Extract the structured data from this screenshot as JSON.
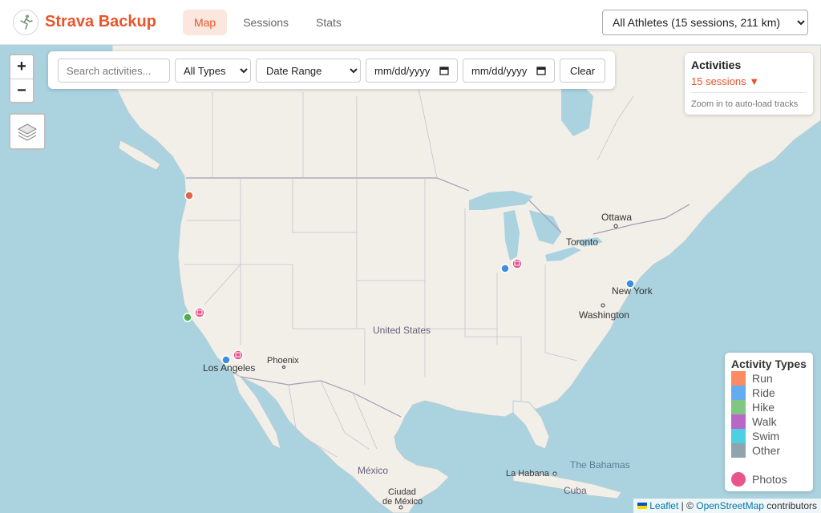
{
  "app": {
    "name": "Strava Backup"
  },
  "nav": {
    "tabs": [
      {
        "label": "Map"
      },
      {
        "label": "Sessions"
      },
      {
        "label": "Stats"
      }
    ]
  },
  "athlete_filter": {
    "selected": "All Athletes (15 sessions, 211 km)"
  },
  "zoom": {
    "in_label": "+",
    "out_label": "−"
  },
  "filters": {
    "search_placeholder": "Search activities...",
    "type_selected": "All Types",
    "range_selected": "Date Range",
    "date_from": "mm/dd/yyyy",
    "date_to": "mm/dd/yyyy",
    "clear_label": "Clear"
  },
  "activities_panel": {
    "title": "Activities",
    "count": "15 sessions ▼",
    "hint": "Zoom in to auto-load tracks"
  },
  "legend": {
    "title": "Activity Types",
    "items": [
      {
        "label": "Run",
        "color": "#fc8b62"
      },
      {
        "label": "Ride",
        "color": "#65abef"
      },
      {
        "label": "Hike",
        "color": "#81c784"
      },
      {
        "label": "Walk",
        "color": "#b967c7"
      },
      {
        "label": "Swim",
        "color": "#4dd0e1"
      },
      {
        "label": "Other",
        "color": "#90a4ae"
      }
    ],
    "photos_label": "Photos",
    "photos_color": "#e6558c"
  },
  "map_labels": {
    "ottawa": "Ottawa",
    "toronto": "Toronto",
    "new_york": "New York",
    "washington": "Washington",
    "united_states": "United States",
    "phoenix": "Phoenix",
    "los_angeles": "Los Angeles",
    "mexico": "México",
    "ciudad": "Ciudad",
    "de_mexico": "de México",
    "la_habana": "La Habana",
    "the_bahamas": "The Bahamas",
    "cuba": "Cuba"
  },
  "attribution": {
    "leaflet": "Leaflet",
    "separator": " | © ",
    "osm": "OpenStreetMap",
    "suffix": " contributors"
  },
  "colors": {
    "brand": "#e8552a",
    "run_marker": "#d9694a",
    "ride_marker": "#3d8ee0",
    "hike_marker": "#4caf50",
    "photo_marker": "#e6558c"
  }
}
